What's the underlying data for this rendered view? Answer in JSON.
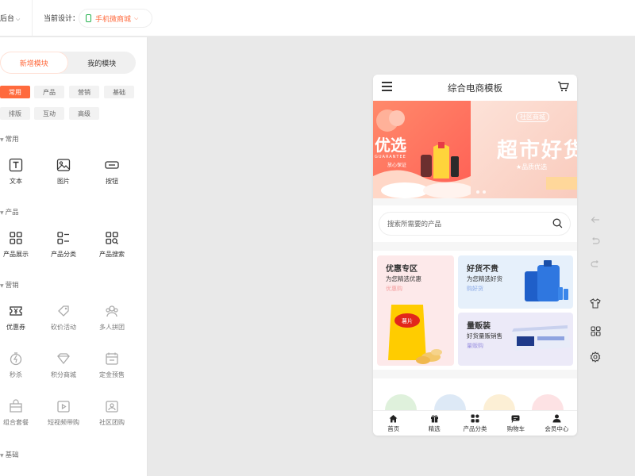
{
  "topbar": {
    "back_label": "后台",
    "current_design_label": "当前设计：",
    "design_selected": "手机微商城"
  },
  "left_panel": {
    "tabs": [
      {
        "label": "新增模块",
        "active": true
      },
      {
        "label": "我的模块",
        "active": false
      }
    ],
    "categories": [
      "常用",
      "产品",
      "营销",
      "基础",
      "排版",
      "互动",
      "高级"
    ],
    "sections": [
      {
        "title": "常用",
        "items": [
          {
            "label": "文本",
            "icon": "text-icon"
          },
          {
            "label": "图片",
            "icon": "image-icon"
          },
          {
            "label": "按钮",
            "icon": "button-icon"
          }
        ]
      },
      {
        "title": "产品",
        "items": [
          {
            "label": "产品展示",
            "icon": "grid-icon"
          },
          {
            "label": "产品分类",
            "icon": "category-icon"
          },
          {
            "label": "产品搜索",
            "icon": "product-search-icon"
          }
        ]
      },
      {
        "title": "营销",
        "items": [
          {
            "label": "优惠券",
            "icon": "coupon-icon"
          },
          {
            "label": "砍价活动",
            "icon": "bargain-icon"
          },
          {
            "label": "多人拼团",
            "icon": "group-buy-icon"
          },
          {
            "label": "秒杀",
            "icon": "flash-sale-icon"
          },
          {
            "label": "积分商城",
            "icon": "points-mall-icon"
          },
          {
            "label": "定金预售",
            "icon": "presale-icon"
          },
          {
            "label": "组合套餐",
            "icon": "combo-icon"
          },
          {
            "label": "短视频带购",
            "icon": "video-shopping-icon"
          },
          {
            "label": "社区团购",
            "icon": "community-icon"
          }
        ]
      },
      {
        "title": "基础",
        "items": []
      }
    ]
  },
  "phone": {
    "title": "综合电商模板",
    "banner": {
      "left_big": "优选",
      "left_guarantee": "GUARANTEE",
      "left_sub": "放心保证",
      "right_big": "超市好货",
      "right_small": "★品质优选",
      "right_top": "社区商城"
    },
    "search_placeholder": "搜索所需要的产品",
    "promos": [
      {
        "title": "优惠专区",
        "subtitle": "为您精选优惠",
        "link": "优惠购"
      },
      {
        "title": "好货不贵",
        "subtitle": "为您精选好货",
        "link": "购好货"
      },
      {
        "title": "量贩装",
        "subtitle": "好货量贩销售",
        "link": "量贩购"
      }
    ],
    "chips_label": "薯片",
    "tabbar": [
      {
        "label": "首页",
        "icon": "home-icon"
      },
      {
        "label": "精选",
        "icon": "gift-icon"
      },
      {
        "label": "产品分类",
        "icon": "category-icon"
      },
      {
        "label": "购物车",
        "icon": "cart-icon"
      },
      {
        "label": "会员中心",
        "icon": "user-icon"
      }
    ]
  },
  "colors": {
    "accent": "#ff6a3d",
    "green": "#23b14d"
  }
}
